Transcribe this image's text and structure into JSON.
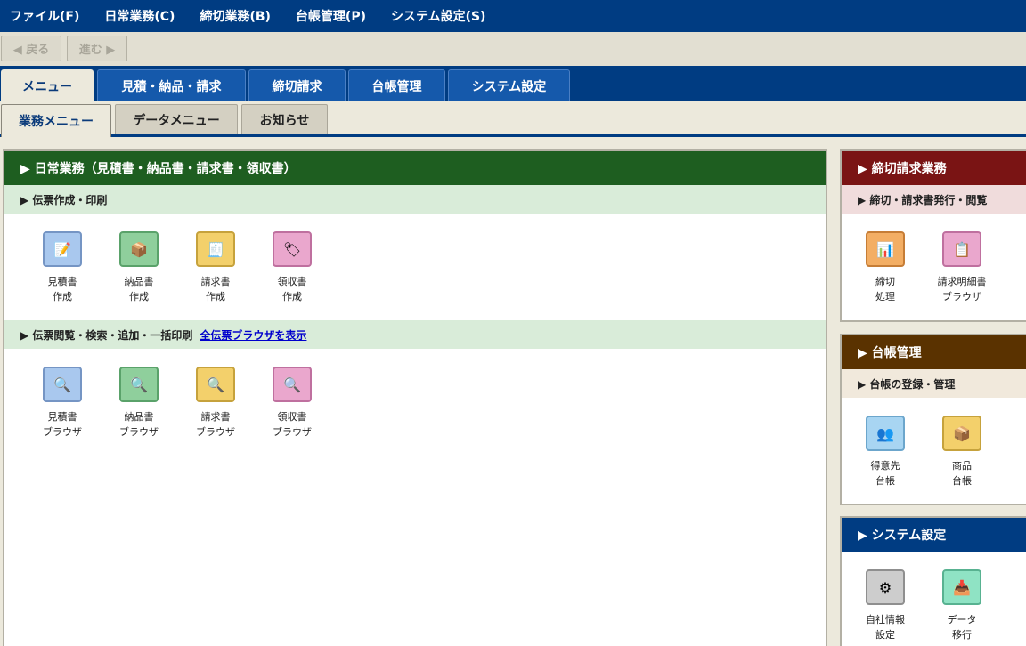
{
  "menubar": {
    "items": [
      "ファイル(F)",
      "日常業務(C)",
      "締切業務(B)",
      "台帳管理(P)",
      "システム設定(S)"
    ]
  },
  "toolbar": {
    "back_label": "◀ 戻る",
    "forward_label": "進む ▶"
  },
  "main_tabs": [
    {
      "label": "メニュー",
      "active": true
    },
    {
      "label": "見積・納品・請求",
      "active": false
    },
    {
      "label": "締切請求",
      "active": false
    },
    {
      "label": "台帳管理",
      "active": false
    },
    {
      "label": "システム設定",
      "active": false
    }
  ],
  "sub_tabs": [
    {
      "label": "業務メニュー",
      "active": true
    },
    {
      "label": "データメニュー",
      "active": false
    },
    {
      "label": "お知らせ",
      "active": false
    }
  ],
  "daily": {
    "header": "▶ 日常業務（見積書・納品書・請求書・領収書）",
    "header_color": "#1e5e20",
    "sections": [
      {
        "title": "▶ 伝票作成・印刷",
        "items": [
          {
            "label": "見積書\n作成",
            "icon": "pencil-document-icon",
            "color": "blue"
          },
          {
            "label": "納品書\n作成",
            "icon": "package-icon",
            "color": "green"
          },
          {
            "label": "請求書\n作成",
            "icon": "receipt-icon",
            "color": "yellow"
          },
          {
            "label": "領収書\n作成",
            "icon": "ticket-icon",
            "color": "pink"
          }
        ]
      },
      {
        "title": "▶ 伝票閲覧・検索・追加・一括印刷",
        "link": "全伝票ブラウザを表示",
        "items": [
          {
            "label": "見積書\nブラウザ",
            "icon": "magnifier-icon",
            "color": "blue"
          },
          {
            "label": "納品書\nブラウザ",
            "icon": "magnifier-icon",
            "color": "green"
          },
          {
            "label": "請求書\nブラウザ",
            "icon": "magnifier-icon",
            "color": "yellow"
          },
          {
            "label": "領収書\nブラウザ",
            "icon": "magnifier-icon",
            "color": "pink"
          }
        ]
      }
    ]
  },
  "closing": {
    "header": "▶ 締切請求業務",
    "header_color": "#7a1414",
    "sub_title": "▶ 締切・請求書発行・閲覧",
    "items": [
      {
        "label": "締切\n処理",
        "icon": "bar-chart-icon",
        "color": "orange"
      },
      {
        "label": "請求明細書\nブラウザ",
        "icon": "clipboard-icon",
        "color": "pink"
      }
    ]
  },
  "ledger": {
    "header": "▶ 台帳管理",
    "header_color": "#5a3200",
    "sub_title": "▶ 台帳の登録・管理",
    "items": [
      {
        "label": "得意先\n台帳",
        "icon": "people-icon",
        "color": "lightblue"
      },
      {
        "label": "商品\n台帳",
        "icon": "box-icon",
        "color": "yellow"
      }
    ]
  },
  "system": {
    "header": "▶ システム設定",
    "header_color": "#003c82",
    "items": [
      {
        "label": "自社情報\n設定",
        "icon": "gear-icon",
        "color": "gray"
      },
      {
        "label": "データ\n移行",
        "icon": "data-transfer-icon",
        "color": "mint"
      }
    ]
  }
}
